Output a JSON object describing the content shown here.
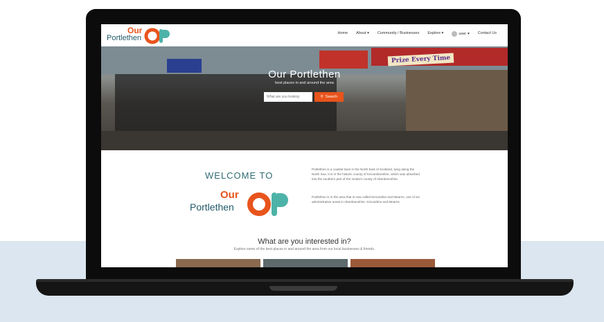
{
  "site": {
    "logo_our": "Our",
    "logo_portlethen": "Portlethen"
  },
  "nav": {
    "items": [
      "Home",
      "About",
      "Community / Businesses",
      "Explore",
      "user",
      "Contact Us"
    ]
  },
  "hero": {
    "title": "Our Portlethen",
    "subtitle": "best places in and around the area",
    "search_placeholder": "What are you looking",
    "search_button": "Search",
    "sign_text": "Prize Every Time"
  },
  "welcome": {
    "heading": "WELCOME TO",
    "para1": "Portlethen is a coastal town in the North East of Scotland, lying along the North Sea. It is in the historic county of Kincardineshire, which was absorbed into the southern part of the modern county of Aberdeenshire.",
    "para2": "Portlethen is in the area that is now called Kincardine and Mearns, one of six administrative areas in Aberdeenshire. Kincardine and Mearns."
  },
  "interest": {
    "title": "What are you interested in?",
    "subtitle": "Explore some of the best places in and around the area from our local businesses & friends."
  },
  "colors": {
    "brand_orange": "#e8541c",
    "brand_teal": "#245a6b",
    "band": "#dbe6f0"
  }
}
